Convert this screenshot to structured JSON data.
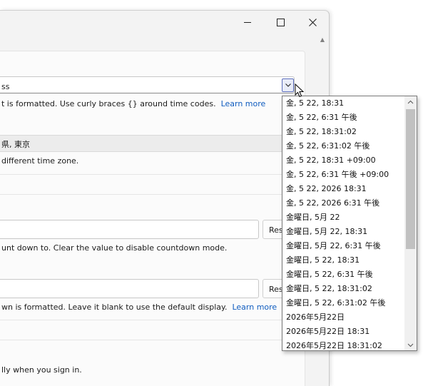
{
  "format_input": {
    "value": "ss"
  },
  "format_help": {
    "text": "t is formatted. Use curly braces {} around time codes.",
    "link": "Learn more"
  },
  "timezone": {
    "value": "県, 東京",
    "help": "different time zone."
  },
  "countdown": {
    "reset_label": "Res",
    "help": "unt down to. Clear the value to disable countdown mode."
  },
  "countdown_format": {
    "reset_label": "Res",
    "help": "wn is formatted. Leave it blank to use the default display.",
    "link": "Learn more"
  },
  "startup": {
    "help": "lly when you sign in."
  },
  "dropdown_items": [
    "金, 5 22, 18:31",
    "金, 5 22, 6:31 午後",
    "金, 5 22, 18:31:02",
    "金, 5 22, 6:31:02 午後",
    "金, 5 22, 18:31 +09:00",
    "金, 5 22, 6:31 午後 +09:00",
    "金, 5 22, 2026 18:31",
    "金, 5 22, 2026 6:31 午後",
    "金曜日, 5月 22",
    "金曜日, 5月 22, 18:31",
    "金曜日, 5月 22, 6:31 午後",
    "金曜日, 5 22, 18:31",
    "金曜日, 5 22, 6:31 午後",
    "金曜日, 5 22, 18:31:02",
    "金曜日, 5 22, 6:31:02 午後",
    "2026年5月22日",
    "2026年5月22日 18:31",
    "2026年5月22日 18:31:02"
  ]
}
